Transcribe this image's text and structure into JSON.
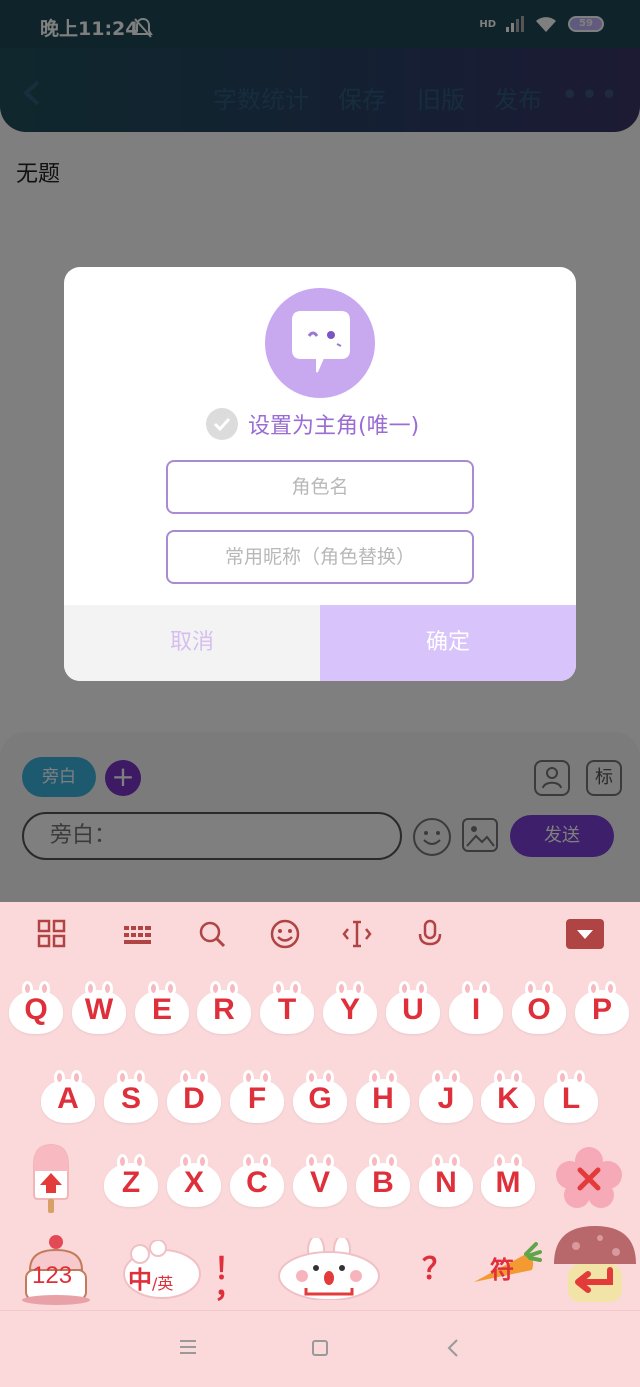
{
  "status_bar": {
    "time": "晚上11:24",
    "battery": "59",
    "network": "HD"
  },
  "toolbar": {
    "word_count": "字数统计",
    "save": "保存",
    "old_version": "旧版",
    "publish": "发布",
    "more": "•••"
  },
  "document": {
    "title": "无题"
  },
  "composer": {
    "role_chip": "旁白",
    "add": "+",
    "tag": "标",
    "input_value": "旁白：",
    "send": "发送"
  },
  "dialog": {
    "main_role_label": "设置为主角(唯一)",
    "role_name_placeholder": "角色名",
    "nickname_placeholder": "常用昵称（角色替换）",
    "cancel": "取消",
    "confirm": "确定"
  },
  "keyboard": {
    "row1": [
      "Q",
      "W",
      "E",
      "R",
      "T",
      "Y",
      "U",
      "I",
      "O",
      "P"
    ],
    "row2": [
      "A",
      "S",
      "D",
      "F",
      "G",
      "H",
      "J",
      "K",
      "L"
    ],
    "row3": [
      "Z",
      "X",
      "C",
      "V",
      "B",
      "N",
      "M"
    ],
    "num_key": "123",
    "lang_key_main": "中",
    "lang_key_sub": "/英",
    "excl": "！",
    "comma": "，",
    "question": "？",
    "sym_key": "符"
  },
  "colors": {
    "accent_purple": "#7a35c7",
    "dialog_confirm": "#d9c3fb",
    "key_text": "#de2f3a",
    "keyboard_bg": "#fbd9da"
  }
}
